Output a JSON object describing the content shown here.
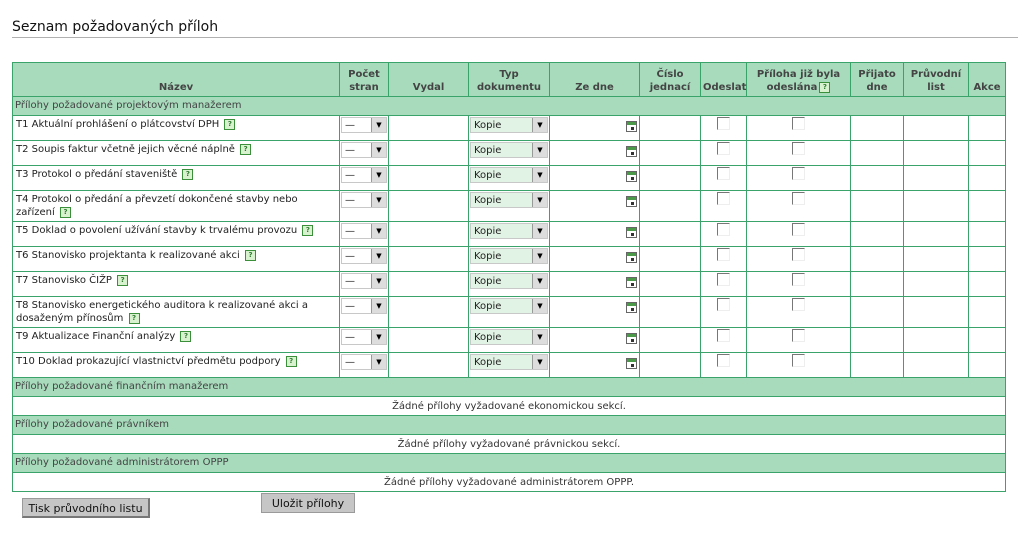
{
  "page": {
    "title": "Seznam požadovaných příloh"
  },
  "table": {
    "headers": {
      "name": "Název",
      "pages": "Počet stran",
      "issued": "Vydal",
      "doctype": "Typ dokumentu",
      "date": "Ze dne",
      "ref": "Číslo jednací",
      "send": "Odeslat",
      "already_sent": "Příloha již byla odeslána",
      "received": "Přijato dne",
      "cover": "Průvodní list",
      "actions": "Akce"
    },
    "sections": [
      {
        "title": "Přílohy požadované projektovým manažerem",
        "empty_text": "",
        "rows": [
          {
            "name": "T1 Aktuální prohlášení o plátcovství DPH",
            "pages": "—",
            "doctype": "Kopie"
          },
          {
            "name": "T2 Soupis faktur včetně jejich věcné náplně",
            "pages": "—",
            "doctype": "Kopie"
          },
          {
            "name": "T3 Protokol o předání staveniště",
            "pages": "—",
            "doctype": "Kopie"
          },
          {
            "name": "T4 Protokol o předání a převzetí dokončené stavby nebo zařízení",
            "pages": "—",
            "doctype": "Kopie"
          },
          {
            "name": "T5 Doklad o povolení užívání stavby k trvalému provozu",
            "pages": "—",
            "doctype": "Kopie"
          },
          {
            "name": "T6 Stanovisko projektanta k realizované akci",
            "pages": "—",
            "doctype": "Kopie"
          },
          {
            "name": "T7 Stanovisko ČIŽP",
            "pages": "—",
            "doctype": "Kopie"
          },
          {
            "name": "T8 Stanovisko energetického auditora k realizované akci a dosaženým přínosům",
            "pages": "—",
            "doctype": "Kopie"
          },
          {
            "name": "T9 Aktualizace Finanční analýzy",
            "pages": "—",
            "doctype": "Kopie"
          },
          {
            "name": "T10 Doklad prokazující vlastnictví předmětu podpory",
            "pages": "—",
            "doctype": "Kopie"
          }
        ]
      },
      {
        "title": "Přílohy požadované finančním manažerem",
        "empty_text": "Žádné přílohy vyžadované ekonomickou sekcí.",
        "rows": []
      },
      {
        "title": "Přílohy požadované právníkem",
        "empty_text": "Žádné přílohy vyžadované právnickou sekcí.",
        "rows": []
      },
      {
        "title": "Přílohy požadované administrátorem OPPP",
        "empty_text": "Žádné přílohy vyžadované administrátorem OPPP.",
        "rows": []
      }
    ]
  },
  "buttons": {
    "print": "Tisk průvodního listu",
    "save": "Uložit přílohy"
  },
  "icons": {
    "help": "help-icon",
    "calendar": "calendar-icon",
    "dropdown": "dropdown-arrow-icon"
  },
  "colors": {
    "header_bg": "#a7dbbc",
    "border": "#3aa36a",
    "button_bg": "#c6c6c6"
  }
}
